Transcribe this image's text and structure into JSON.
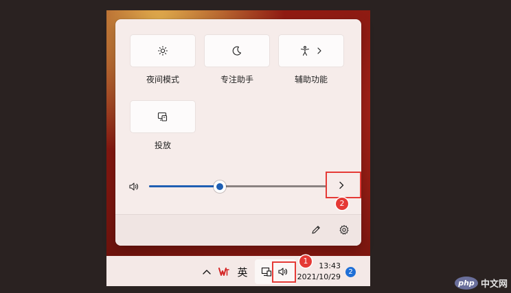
{
  "quick_settings": {
    "tiles": [
      {
        "label": "夜间模式",
        "icon": "night-light-icon"
      },
      {
        "label": "专注助手",
        "icon": "moon-icon"
      },
      {
        "label": "辅助功能",
        "icon": "accessibility-icon",
        "has_chevron": true
      },
      {
        "label": "投放",
        "icon": "cast-icon"
      }
    ],
    "volume": {
      "icon": "speaker-icon",
      "level_percent": 40
    },
    "footer": {
      "edit_icon": "pencil-icon",
      "settings_icon": "gear-icon"
    }
  },
  "taskbar": {
    "overflow_icon": "chevron-up-icon",
    "app_icon": "wps-icon",
    "ime_label": "英",
    "network_icon": "network-icon",
    "volume_icon": "speaker-icon",
    "time": "13:43",
    "date": "2021/10/29",
    "notification_count": "2"
  },
  "annotations": {
    "badge_1": "1",
    "badge_2": "2",
    "color": "#e53935"
  },
  "watermark": {
    "logo": "php",
    "text": "中文网"
  }
}
